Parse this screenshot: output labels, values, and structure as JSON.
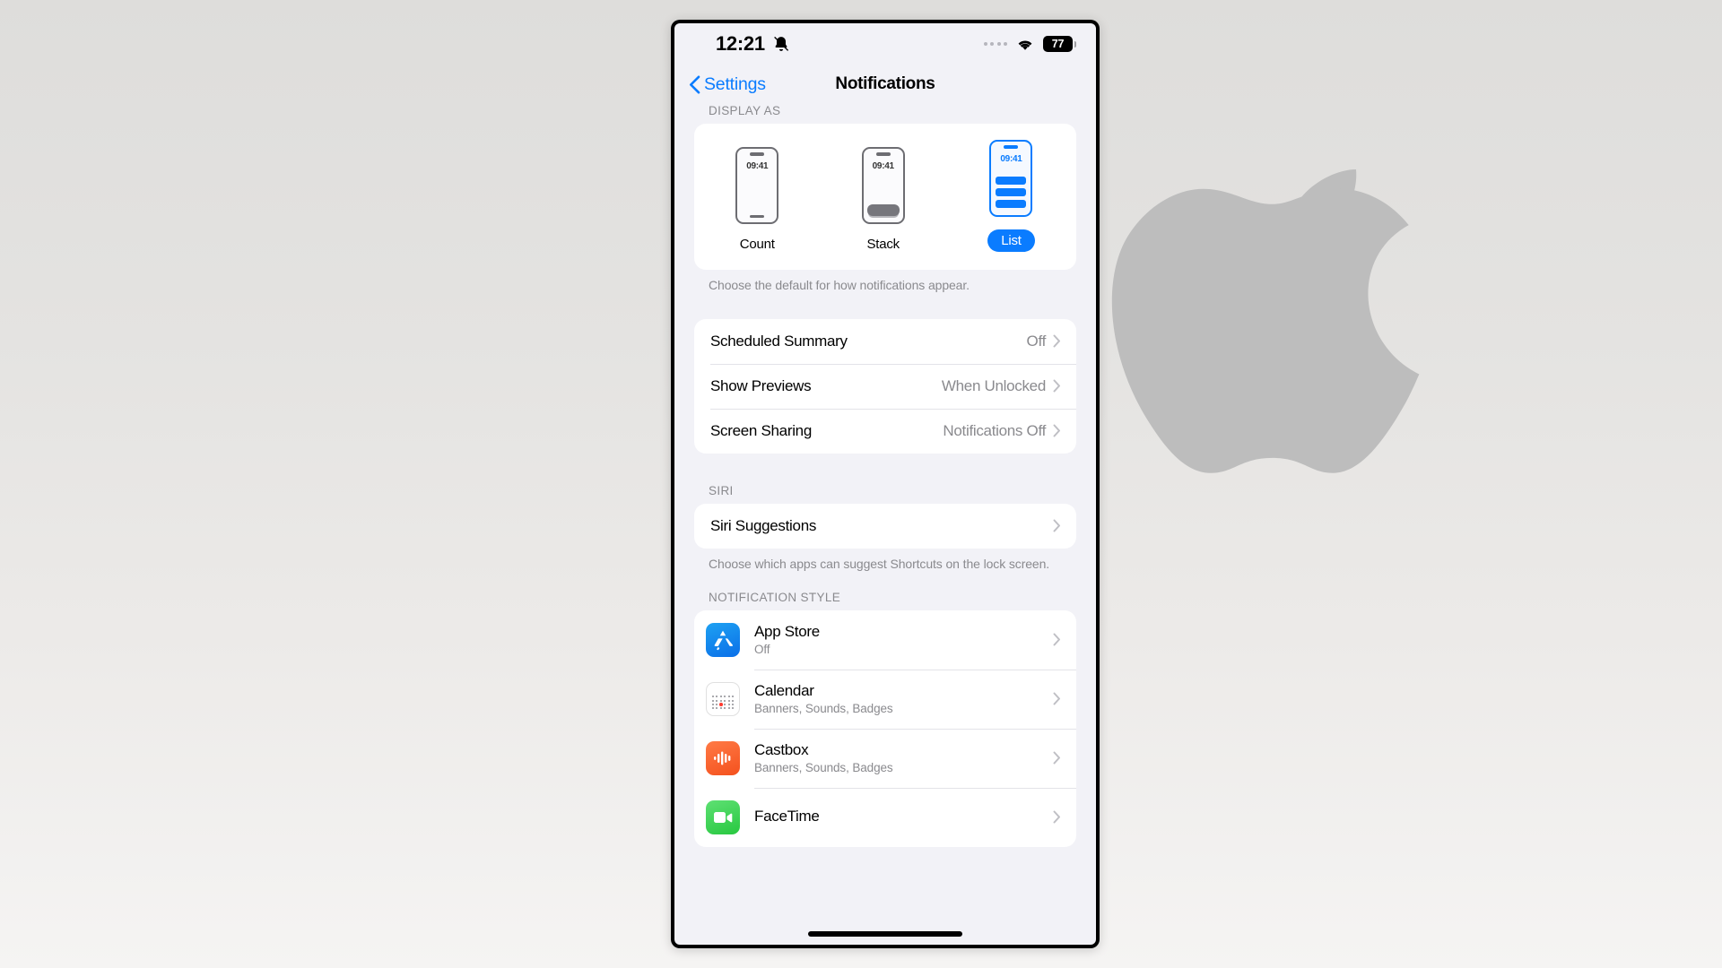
{
  "background": {
    "watermark_icon": "apple-logo-icon",
    "watermark_color": "#bdbdbd",
    "gradient_top": "#dedddb",
    "gradient_bottom": "#f5f4f3"
  },
  "status_bar": {
    "time": "12:21",
    "silent_icon": "bell-slash-icon",
    "cellular_icon": "cellular-dots-icon",
    "wifi_icon": "wifi-icon",
    "battery_level": "77"
  },
  "nav_bar": {
    "back_label": "Settings",
    "back_icon": "chevron-left-icon",
    "title": "Notifications"
  },
  "display_as": {
    "header": "DISPLAY AS",
    "footer": "Choose the default for how notifications appear.",
    "preview_time": "09:41",
    "options": [
      {
        "label": "Count",
        "selected": false
      },
      {
        "label": "Stack",
        "selected": false
      },
      {
        "label": "List",
        "selected": true
      }
    ]
  },
  "general_rows": [
    {
      "label": "Scheduled Summary",
      "value": "Off"
    },
    {
      "label": "Show Previews",
      "value": "When Unlocked"
    },
    {
      "label": "Screen Sharing",
      "value": "Notifications Off"
    }
  ],
  "siri": {
    "header": "SIRI",
    "row_label": "Siri Suggestions",
    "footer": "Choose which apps can suggest Shortcuts on the lock screen."
  },
  "notification_style": {
    "header": "NOTIFICATION STYLE",
    "apps": [
      {
        "name": "App Store",
        "status": "Off",
        "icon": "app-store-icon",
        "color": "#0a7cff"
      },
      {
        "name": "Calendar",
        "status": "Banners, Sounds, Badges",
        "icon": "calendar-icon",
        "color": "#ff3b30"
      },
      {
        "name": "Castbox",
        "status": "Banners, Sounds, Badges",
        "icon": "castbox-icon",
        "color": "#f4511e"
      },
      {
        "name": "FaceTime",
        "status": "",
        "icon": "facetime-icon",
        "color": "#28c840"
      }
    ]
  },
  "home_indicator": {
    "label": "home-indicator"
  },
  "accent_color": "#0a7cff"
}
